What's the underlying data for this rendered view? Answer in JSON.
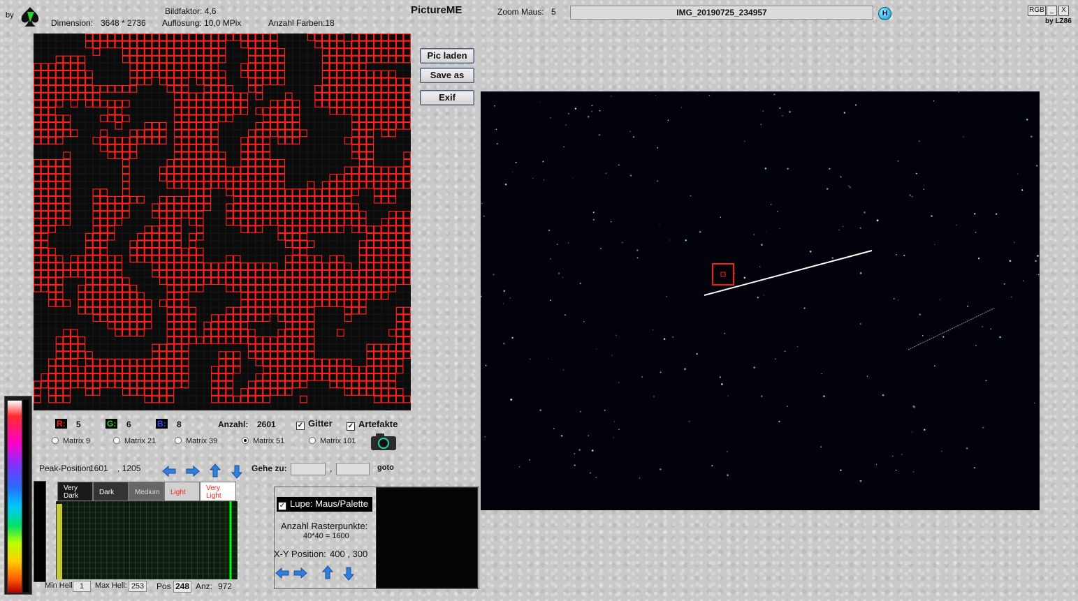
{
  "header": {
    "by_prefix": "by",
    "bildfaktor": "Bildfaktor: 4,6",
    "dimension_label": "Dimension:",
    "dimension_value": "3648 * 2736",
    "aufloesung": "Auflösung: 10,0 MPix",
    "anzahl_farben": "Anzahl Farben:18",
    "app_title": "PictureME",
    "zoom_label": "Zoom Maus:",
    "zoom_value": "5",
    "filename": "IMG_20190725_234957",
    "help_glyph": "H",
    "rgb_label": "RGB",
    "minimize": "_",
    "close": "X",
    "by_lz86": "by LZ86"
  },
  "buttons": {
    "pic_laden": "Pic laden",
    "save_as": "Save as",
    "exif": "Exif"
  },
  "stats": {
    "r_label": "R:",
    "r_value": "5",
    "g_label": "G:",
    "g_value": "6",
    "b_label": "B:",
    "b_value": "8",
    "anzahl_label": "Anzahl:",
    "anzahl_value": "2601",
    "gitter_label": "Gitter",
    "gitter_checked": true,
    "artefakte_label": "Artefakte",
    "artefakte_checked": true
  },
  "matrix_options": [
    {
      "label": "Matrix 9",
      "selected": false
    },
    {
      "label": "Matrix 21",
      "selected": false
    },
    {
      "label": "Matrix 39",
      "selected": false
    },
    {
      "label": "Matrix 51",
      "selected": true
    },
    {
      "label": "Matrix 101",
      "selected": false
    }
  ],
  "peak": {
    "label": "Peak-Position:",
    "x": "1601",
    "y": ", 1205"
  },
  "goto": {
    "label": "Gehe zu:",
    "separator": ",",
    "button": "goto",
    "x_value": "",
    "y_value": ""
  },
  "tones": [
    {
      "line1": "Very",
      "line2": "Dark",
      "bg": "#1a1a1a",
      "color": "#ffffff"
    },
    {
      "line1": "Dark",
      "line2": "",
      "bg": "#333333",
      "color": "#ffffff"
    },
    {
      "line1": "Medium",
      "line2": "",
      "bg": "#666666",
      "color": "#dddddd"
    },
    {
      "line1": "Light",
      "line2": "",
      "bg": "#d0d0d0",
      "color": "#ff2020"
    },
    {
      "line1": "Very",
      "line2": "Light",
      "bg": "#ffffff",
      "color": "#ff2020"
    }
  ],
  "histogram_footer": {
    "min_label": "Min Hell:",
    "min_value": "1",
    "max_label": "Max Hell:",
    "max_value": "253",
    "pos_label": "Pos",
    "pos_value": "248",
    "anz_label": "Anz:",
    "anz_value": "972"
  },
  "lupe": {
    "checkbox_label": "Lupe: Maus/Palette",
    "checked": true,
    "raster_label": "Anzahl Rasterpunkte:",
    "raster_value": "40*40 = 1600",
    "xy_label": "X-Y Position:",
    "xy_value": "400 , 300"
  },
  "colors": {
    "grid_red": "#ff2020",
    "accent_blue": "#2f7fe0",
    "hist_green": "#00ff00"
  },
  "icons": {
    "camera": "camera-icon",
    "logo": "spade-logo-icon",
    "help": "help-icon"
  }
}
